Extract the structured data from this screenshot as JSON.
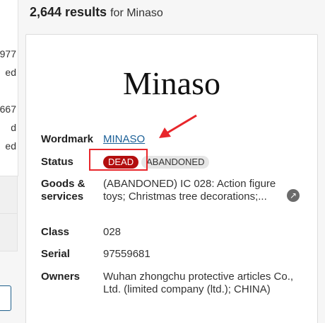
{
  "results": {
    "count": "2,644 results",
    "query_text": "for Minaso"
  },
  "left_fragments": [
    "977",
    "ed",
    "667",
    "d",
    "ed"
  ],
  "card": {
    "mark_name": "Minaso",
    "fields": {
      "wordmark_label": "Wordmark",
      "wordmark_value": "MINASO",
      "status_label": "Status",
      "status_dead": "DEAD",
      "status_abandoned": "ABANDONED",
      "goods_label_line1": "Goods &",
      "goods_label_line2": "services",
      "goods_value": "(ABANDONED) IC 028: Action figure toys; Christmas tree decorations;...",
      "class_label": "Class",
      "class_value": "028",
      "serial_label": "Serial",
      "serial_value": "97559681",
      "owners_label": "Owners",
      "owners_value": "Wuhan zhongchu protective articles Co., Ltd. (limited company (ltd.); CHINA)"
    }
  },
  "icons": {
    "external_link": "external-link-icon",
    "annotation_arrow": "annotation-arrow-icon"
  },
  "colors": {
    "dead_badge": "#b30e0e",
    "annotation_red": "#e8262b",
    "link": "#1a5f97"
  }
}
